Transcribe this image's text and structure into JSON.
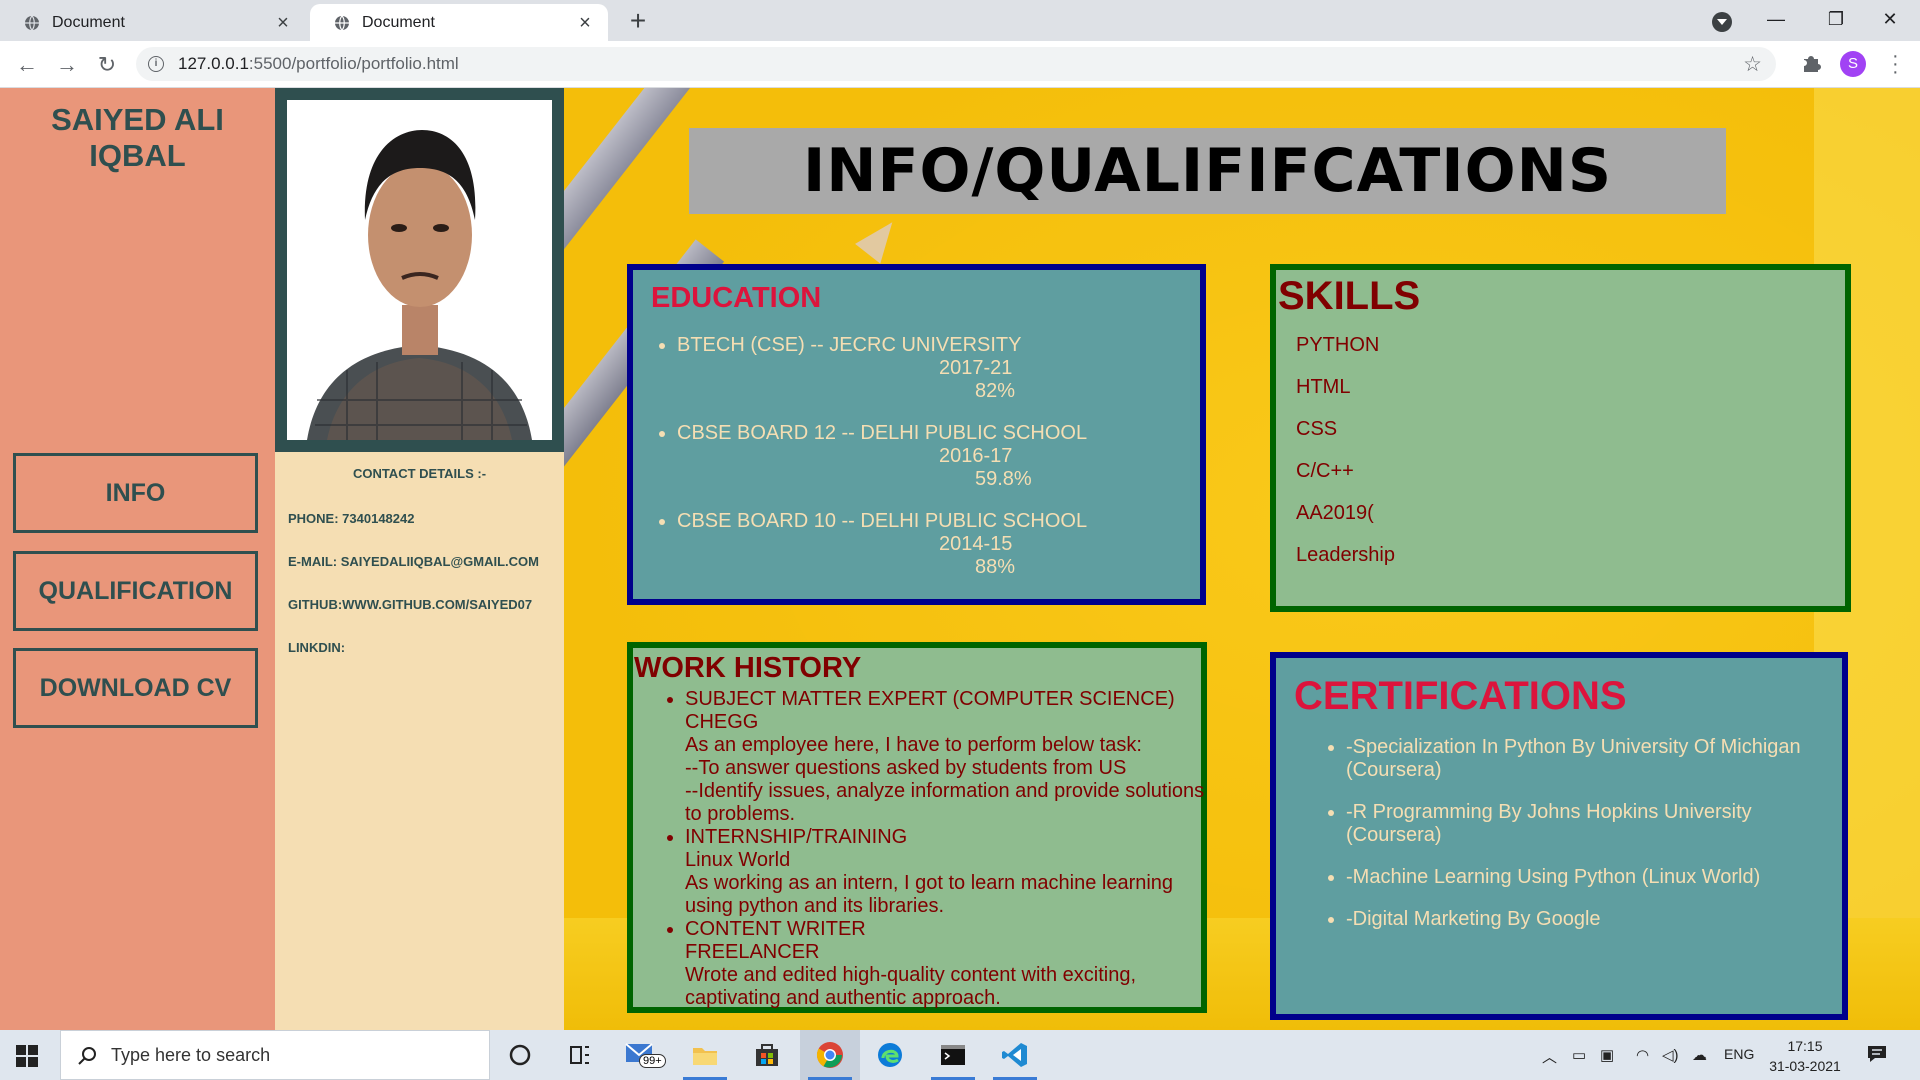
{
  "browser": {
    "tabs": [
      {
        "title": "Document",
        "active": false
      },
      {
        "title": "Document",
        "active": true
      }
    ],
    "url_host": "127.0.0.1",
    "url_rest": ":5500/portfolio/portfolio.html",
    "profile_initial": "S"
  },
  "sidebar": {
    "name": "SAIYED ALI IQBAL",
    "buttons": [
      "INFO",
      "QUALIFICATION",
      "DOWNLOAD CV"
    ]
  },
  "contact": {
    "heading": "CONTACT DETAILS :-",
    "phone": "PHONE: 7340148242",
    "email": "E-MAIL: SAIYEDALIIQBAL@GMAIL.COM",
    "github": "GITHUB:WWW.GITHUB.COM/SAIYED07",
    "linkedin": "LINKDIN:"
  },
  "main": {
    "title": "INFO/QUALIFIFCATIONS",
    "education": {
      "heading": "EDUCATION",
      "items": [
        {
          "title": "BTECH (CSE) -- JECRC UNIVERSITY",
          "years": "2017-21",
          "score": "82%"
        },
        {
          "title": "CBSE BOARD 12 -- DELHI PUBLIC SCHOOL",
          "years": "2016-17",
          "score": "59.8%"
        },
        {
          "title": "CBSE BOARD 10 -- DELHI PUBLIC SCHOOL",
          "years": "2014-15",
          "score": "88%"
        }
      ]
    },
    "skills": {
      "heading": "SKILLS",
      "items": [
        "PYTHON",
        "HTML",
        "CSS",
        "C/C++",
        "AA2019(",
        "Leadership"
      ]
    },
    "work": {
      "heading": "WORK HISTORY",
      "items": [
        {
          "role": "SUBJECT MATTER EXPERT (COMPUTER SCIENCE)",
          "org": "CHEGG",
          "desc": "As an employee here, I have to perform below task:",
          "desc2": "--To answer questions asked by students from US",
          "desc3": "--Identify issues, analyze information and provide solutions to problems."
        },
        {
          "role": "INTERNSHIP/TRAINING",
          "org": "Linux World",
          "desc": "As working as an intern, I got to learn machine learning using python and its libraries."
        },
        {
          "role": "CONTENT WRITER",
          "org": "FREELANCER",
          "desc": "Wrote and edited high-quality content with exciting, captivating and authentic approach."
        }
      ]
    },
    "certifications": {
      "heading": "CERTIFICATIONS",
      "items": [
        "-Specialization In Python By University Of Michigan (Coursera)",
        "-R Programming By Johns Hopkins University (Coursera)",
        "-Machine Learning Using Python (Linux World)",
        "-Digital Marketing By Google"
      ]
    }
  },
  "taskbar": {
    "search_placeholder": "Type here to search",
    "mail_badge": "99+",
    "language": "ENG",
    "time": "17:15",
    "date": "31-03-2021"
  },
  "colors": {
    "sidebar": "#e9967a",
    "contact_bg": "#f5deb3",
    "dark_slate": "#2f4f4f",
    "content_bg": "#f4be0a",
    "education_bg": "#5f9ea0",
    "skills_bg": "#8fbc8f",
    "crimson": "#dc143c",
    "maroon": "#800000"
  }
}
